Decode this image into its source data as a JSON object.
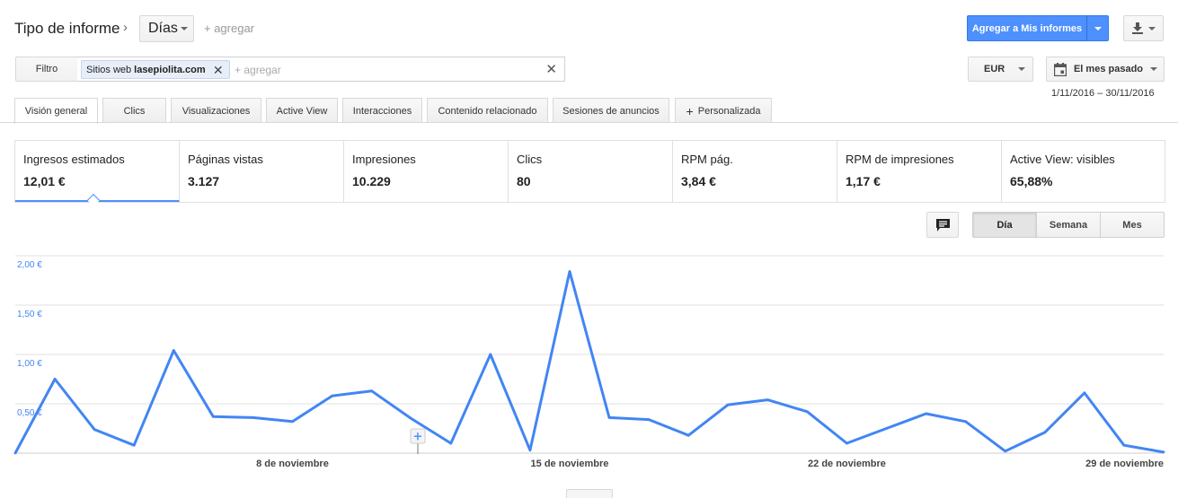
{
  "header": {
    "title": "Tipo de informe",
    "breadcrumb_separator": "›",
    "report_type": "Días",
    "add_dimension": "+ agregar",
    "add_report_button": "Agregar a Mis informes"
  },
  "filter": {
    "button_label": "Filtro",
    "chip_prefix": "Sitios web",
    "chip_value": "lasepiolita.com",
    "add_placeholder": "+ agregar"
  },
  "controls": {
    "currency": "EUR",
    "date_preset": "El mes pasado",
    "date_range": "1/11/2016 – 30/11/2016"
  },
  "tabs": [
    {
      "label": "Visión general",
      "active": true
    },
    {
      "label": "Clics"
    },
    {
      "label": "Visualizaciones"
    },
    {
      "label": "Active View"
    },
    {
      "label": "Interacciones"
    },
    {
      "label": "Contenido relacionado"
    },
    {
      "label": "Sesiones de anuncios"
    },
    {
      "label": "Personalizada"
    }
  ],
  "metrics": [
    {
      "label": "Ingresos estimados",
      "value": "12,01 €",
      "active": true
    },
    {
      "label": "Páginas vistas",
      "value": "3.127"
    },
    {
      "label": "Impresiones",
      "value": "10.229"
    },
    {
      "label": "Clics",
      "value": "80"
    },
    {
      "label": "RPM pág.",
      "value": "3,84 €"
    },
    {
      "label": "RPM de impresiones",
      "value": "1,17 €"
    },
    {
      "label": "Active View: visibles",
      "value": "65,88%"
    }
  ],
  "granularity": [
    "Día",
    "Semana",
    "Mes"
  ],
  "icons": {
    "chevron": "chevron-right-icon",
    "download": "download-icon",
    "calendar": "calendar-icon",
    "annotation": "comment-icon",
    "add_annotation": "plus-icon"
  },
  "colors": {
    "accent": "#4d90fe",
    "line": "#4285f4",
    "axis_label": "#4285f4"
  },
  "chart_data": {
    "type": "line",
    "series": [
      {
        "values": [
          0.0,
          0.75,
          0.24,
          0.08,
          1.04,
          0.37,
          0.36,
          0.32,
          0.58,
          0.63,
          0.35,
          0.1,
          1.0,
          0.03,
          1.84,
          0.36,
          0.34,
          0.18,
          0.49,
          0.54,
          0.42,
          0.1,
          0.25,
          0.4,
          0.32,
          0.02,
          0.21,
          0.61,
          0.08,
          0.01
        ]
      }
    ],
    "x_ticks": [
      {
        "day": 8,
        "label": "8 de noviembre"
      },
      {
        "day": 15,
        "label": "15 de noviembre"
      },
      {
        "day": 22,
        "label": "22 de noviembre"
      },
      {
        "day": 29,
        "label": "29 de noviembre"
      }
    ],
    "y_ticks": [
      "2,00 €",
      "1,50 €",
      "1,00 €",
      "0,50 €"
    ],
    "y_tick_values": [
      2.0,
      1.5,
      1.0,
      0.5
    ],
    "ylim": [
      0,
      2.0
    ],
    "grid": true
  }
}
